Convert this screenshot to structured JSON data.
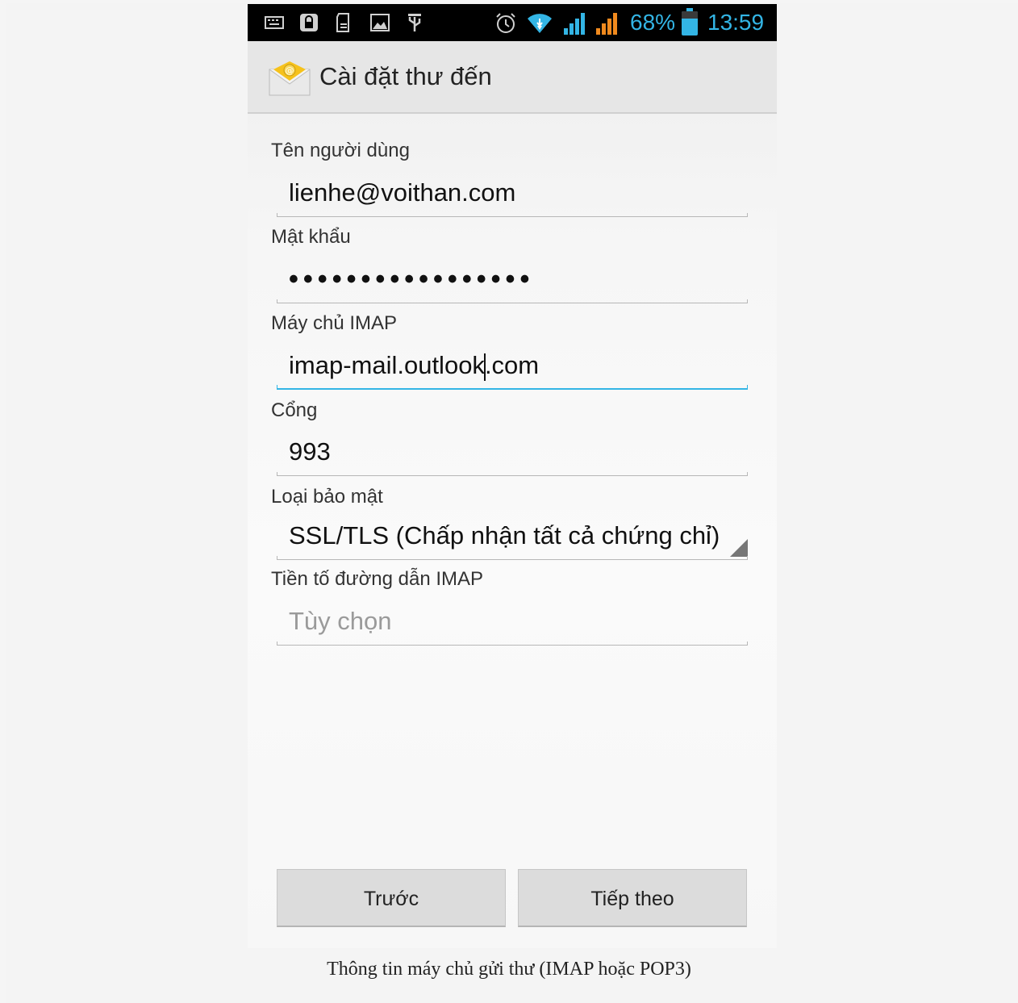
{
  "status_bar": {
    "battery_text": "68%",
    "time": "13:59",
    "icons": [
      "keyboard-icon",
      "lock-icon",
      "sd-card-icon",
      "image-icon",
      "usb-icon",
      "alarm-icon",
      "wifi-icon",
      "signal-icon",
      "signal-roaming-icon",
      "battery-icon"
    ]
  },
  "action_bar": {
    "title": "Cài đặt thư đến",
    "icon": "email-icon"
  },
  "form": {
    "username": {
      "label": "Tên người dùng",
      "value": "lienhe@voithan.com"
    },
    "password": {
      "label": "Mật khẩu",
      "value": "•••••••••••••••••"
    },
    "imap_server": {
      "label": "Máy chủ IMAP",
      "value_before_cursor": "imap-mail.outlook",
      "value_after_cursor": ".com"
    },
    "port": {
      "label": "Cổng",
      "value": "993"
    },
    "security": {
      "label": "Loại bảo mật",
      "value": "SSL/TLS (Chấp nhận tất cả chứng chỉ)"
    },
    "path_prefix": {
      "label": "Tiền tố đường dẫn IMAP",
      "placeholder": "Tùy chọn"
    }
  },
  "buttons": {
    "previous": "Trước",
    "next": "Tiếp theo"
  },
  "caption": "Thông tin máy chủ gửi thư (IMAP hoặc POP3)",
  "colors": {
    "accent": "#33b5e5",
    "signal_orange": "#f08a1e"
  }
}
